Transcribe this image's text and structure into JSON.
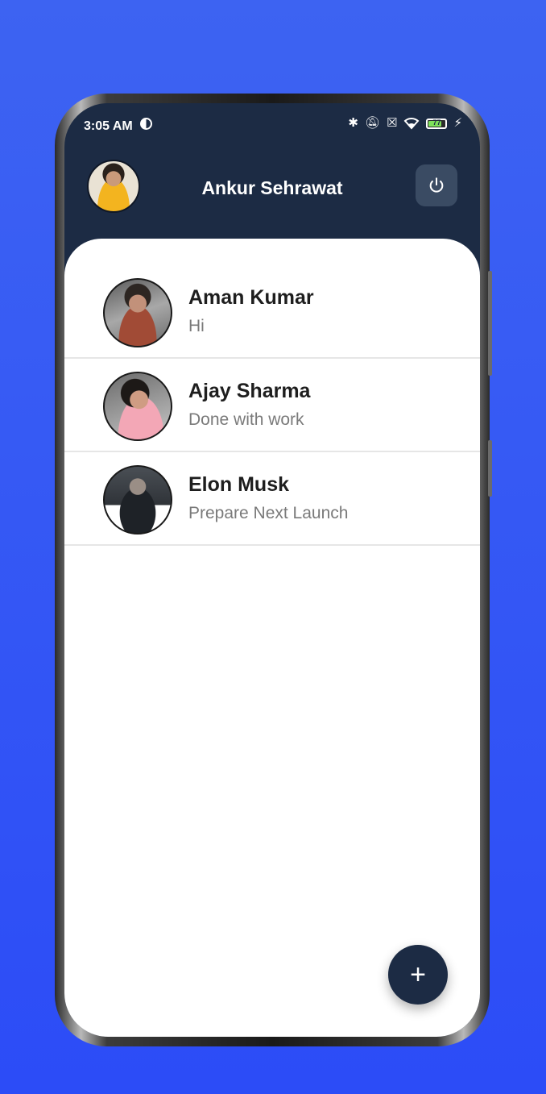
{
  "statusbar": {
    "time": "3:05 AM",
    "battery_level": "77",
    "battery_fraction": 0.77,
    "icons": [
      "bluetooth-icon",
      "mute-icon",
      "sim-icon",
      "wifi-icon",
      "battery-icon",
      "charging-icon"
    ]
  },
  "header": {
    "title": "Ankur Sehrawat",
    "power_icon": "power-icon"
  },
  "chats": [
    {
      "name": "Aman Kumar",
      "message": "Hi"
    },
    {
      "name": "Ajay Sharma",
      "message": "Done with work"
    },
    {
      "name": "Elon Musk",
      "message": "Prepare Next Launch"
    }
  ],
  "fab": {
    "label": "+"
  },
  "colors": {
    "background": "#3d63f2",
    "header": "#1c2b44",
    "power_button": "#3a4b63",
    "card": "#ffffff"
  }
}
